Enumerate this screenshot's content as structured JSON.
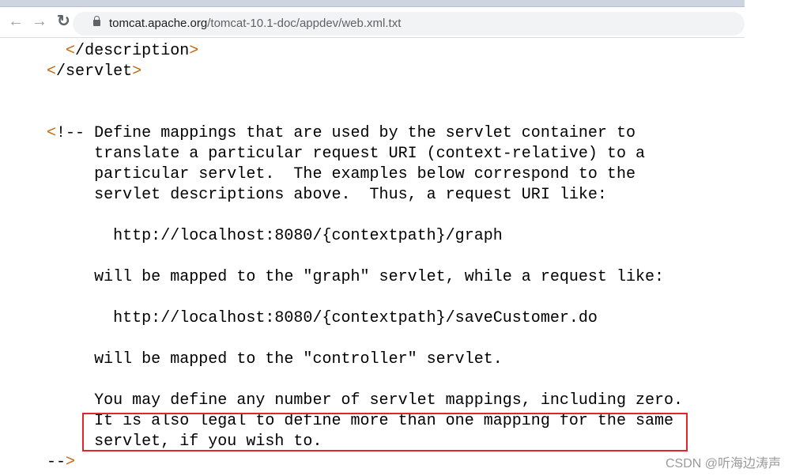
{
  "browser": {
    "back_icon": "arrow-left-icon",
    "forward_icon": "arrow-right-icon",
    "reload_icon": "reload-icon",
    "lock_icon": "lock-icon",
    "url_host": "tomcat.apache.org",
    "url_path": "/tomcat-10.1-doc/appdev/web.xml.txt"
  },
  "document": {
    "lines": [
      "  </description>",
      "</servlet>",
      "",
      "",
      "<!-- Define mappings that are used by the servlet container to",
      "     translate a particular request URI (context-relative) to a",
      "     particular servlet.  The examples below correspond to the",
      "     servlet descriptions above.  Thus, a request URI like:",
      "",
      "       http://localhost:8080/{contextpath}/graph",
      "",
      "     will be mapped to the \"graph\" servlet, while a request like:",
      "",
      "       http://localhost:8080/{contextpath}/saveCustomer.do",
      "",
      "     will be mapped to the \"controller\" servlet.",
      "",
      "     You may define any number of servlet mappings, including zero.",
      "     It is also legal to define more than one mapping for the same",
      "     servlet, if you wish to.",
      "-->"
    ]
  },
  "annotation": {
    "highlight_color": "#e3242b",
    "bracket_color": "#c0680e"
  },
  "watermark": "CSDN @听海边涛声"
}
